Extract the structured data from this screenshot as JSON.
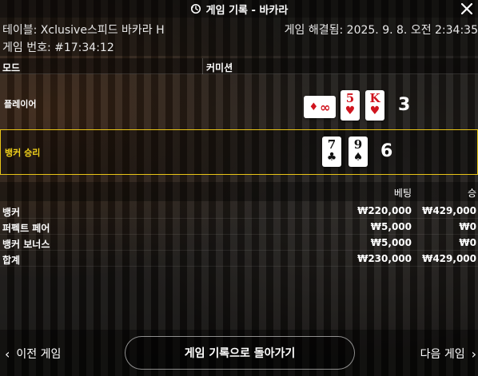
{
  "header": {
    "title": "게임 기록 - 바카라"
  },
  "info": {
    "table": "테이블: Xclusive스피드 바카라 H",
    "round": "게임 번호: #17:34:12",
    "resolved": "게임 해결됨: 2025. 9. 8. 오전 2:34:35"
  },
  "mode": {
    "mode_label": "모드",
    "commission_label": "커미션"
  },
  "player": {
    "label": "플레이어",
    "score": "3",
    "cards": [
      {
        "rank": "∞",
        "suit": "♦",
        "color": "#d0141e",
        "orientation": "sideways"
      },
      {
        "rank": "5",
        "suit": "♥",
        "color": "#d0141e"
      },
      {
        "rank": "K",
        "suit": "♥",
        "color": "#d0141e"
      }
    ]
  },
  "banker": {
    "label": "뱅커 승리",
    "score": "6",
    "cards": [
      {
        "rank": "7",
        "suit": "♣",
        "color": "#111111"
      },
      {
        "rank": "9",
        "suit": "♠",
        "color": "#111111"
      }
    ]
  },
  "bets": {
    "col_bet": "베팅",
    "col_win": "승",
    "rows": [
      {
        "name": "뱅커",
        "bet": "₩220,000",
        "win": "₩429,000"
      },
      {
        "name": "퍼펙트 페어",
        "bet": "₩5,000",
        "win": "₩0"
      },
      {
        "name": "뱅커 보너스",
        "bet": "₩5,000",
        "win": "₩0"
      },
      {
        "name": "합계",
        "bet": "₩230,000",
        "win": "₩429,000"
      }
    ]
  },
  "footer": {
    "prev": "이전 게임",
    "back": "게임 기록으로 돌아가기",
    "next": "다음 게임"
  },
  "colors": {
    "banker_highlight": "#e8c417",
    "card_red": "#d0141e"
  }
}
